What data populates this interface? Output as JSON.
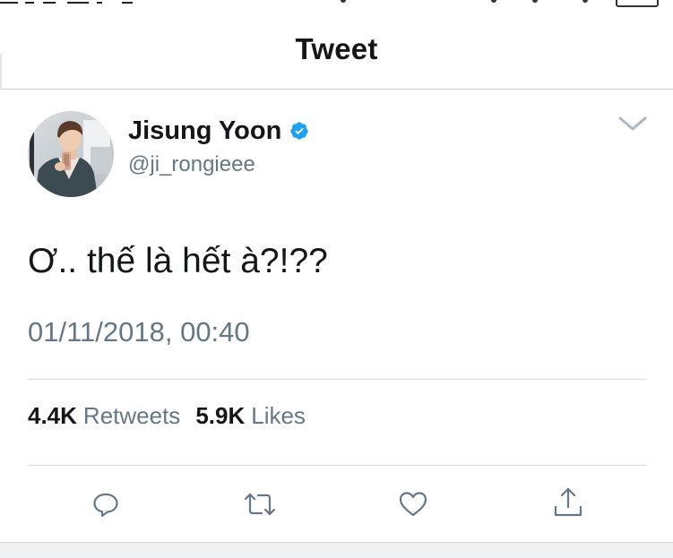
{
  "header": {
    "title": "Tweet"
  },
  "author": {
    "display_name": "Jisung Yoon",
    "handle": "@ji_rongieee",
    "verified": true,
    "avatar_icon": "profile-photo"
  },
  "tweet": {
    "text": "Ơ.. thế là hết à?!??",
    "timestamp": "01/11/2018, 00:40"
  },
  "stats": {
    "retweets_count": "4.4K",
    "retweets_label": "Retweets",
    "likes_count": "5.9K",
    "likes_label": "Likes"
  },
  "actions": [
    {
      "icon": "reply-icon"
    },
    {
      "icon": "retweet-icon"
    },
    {
      "icon": "like-icon"
    },
    {
      "icon": "share-icon"
    }
  ],
  "colors": {
    "accent": "#1da1f2",
    "text": "#14171a",
    "secondary_text": "#657786",
    "divider": "#d6dadd",
    "icon": "#657786"
  }
}
